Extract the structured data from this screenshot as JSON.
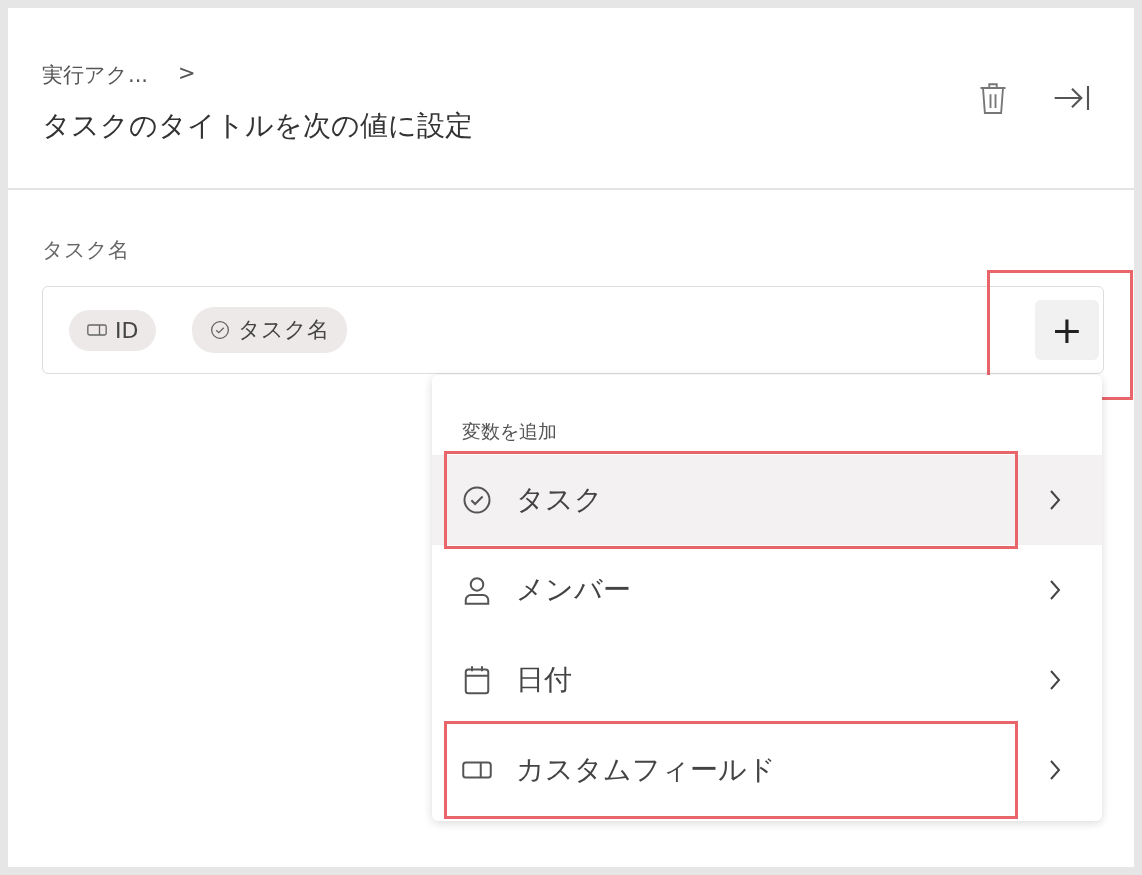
{
  "header": {
    "breadcrumb": "実行アク...",
    "breadcrumb_separator": ">",
    "title": "タスクのタイトルを次の値に設定"
  },
  "field": {
    "label": "タスク名",
    "chips": [
      {
        "kind": "tag",
        "label": "ID"
      },
      {
        "kind": "check",
        "label": "タスク名"
      }
    ],
    "add_button": {
      "label": "+",
      "highlighted": true
    }
  },
  "menu": {
    "header": "変数を追加",
    "items": [
      {
        "kind": "check",
        "label": "タスク",
        "selected": true,
        "highlighted": true
      },
      {
        "kind": "person",
        "label": "メンバー",
        "selected": false,
        "highlighted": false
      },
      {
        "kind": "calendar",
        "label": "日付",
        "selected": false,
        "highlighted": false
      },
      {
        "kind": "tag",
        "label": "カスタムフィールド",
        "selected": false,
        "highlighted": true
      }
    ]
  }
}
